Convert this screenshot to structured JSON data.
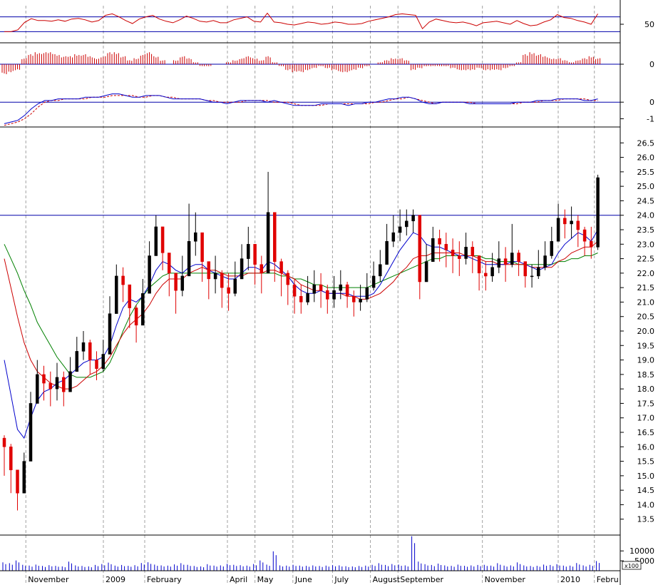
{
  "chart_data": {
    "type": "candlestick",
    "colors": {
      "up_candle": "#000000",
      "down_candle": "#e00000",
      "ma_short": "#0000cc",
      "ma_medium": "#cc0000",
      "ma_long": "#008000",
      "rsi": "#cc0000",
      "histogram": "#cc0000",
      "macd": "#0000cc",
      "signal": "#cc0000",
      "volume": "#0000cc",
      "reference_line": "#0000aa",
      "grid": "#a0a0a0"
    },
    "x_axis": {
      "months": [
        {
          "label": "November",
          "week": 0.0
        },
        {
          "label": "2009",
          "week": 4.5
        },
        {
          "label": "February",
          "week": 6.9
        },
        {
          "label": "April",
          "week": 11.7
        },
        {
          "label": "May",
          "week": 13.3
        },
        {
          "label": "June",
          "week": 15.5
        },
        {
          "label": "July",
          "week": 17.8
        },
        {
          "label": "August",
          "week": 20.0
        },
        {
          "label": "September",
          "week": 21.6
        },
        {
          "label": "November",
          "week": 26.5
        },
        {
          "label": "2010",
          "week": 30.9
        },
        {
          "label": "Febru",
          "week": 33.0
        }
      ],
      "week_range": [
        -1.5,
        34.5
      ]
    },
    "price_panel": {
      "ylim": [
        13.0,
        27.0
      ],
      "ticks": [
        "13.5",
        "14.0",
        "14.5",
        "15.0",
        "15.5",
        "16.0",
        "16.5",
        "17.0",
        "17.5",
        "18.0",
        "18.5",
        "19.0",
        "19.5",
        "20.0",
        "20.5",
        "21.0",
        "21.5",
        "22.0",
        "22.5",
        "23.0",
        "23.5",
        "24.0",
        "24.5",
        "25.0",
        "25.5",
        "26.0",
        "26.5"
      ],
      "reference_line": 24.0,
      "close": [
        16.0,
        15.2,
        14.4,
        15.5,
        17.5,
        18.5,
        18.2,
        18.0,
        18.4,
        17.9,
        18.6,
        19.3,
        19.6,
        19.0,
        18.7,
        19.2,
        20.6,
        21.9,
        21.6,
        20.8,
        20.2,
        21.3,
        22.6,
        23.6,
        22.7,
        22.0,
        21.4,
        21.9,
        23.1,
        23.4,
        22.4,
        21.8,
        22.0,
        21.5,
        21.3,
        21.8,
        22.5,
        23.0,
        22.3,
        22.0,
        24.1,
        22.4,
        22.0,
        21.6,
        21.2,
        21.0,
        21.3,
        21.6,
        21.4,
        21.1,
        21.4,
        21.6,
        21.2,
        21.0,
        21.1,
        21.5,
        21.9,
        22.3,
        23.1,
        23.4,
        23.6,
        23.8,
        24.0,
        21.7,
        22.4,
        23.2,
        23.0,
        22.8,
        22.6,
        22.5,
        22.9,
        22.6,
        22.0,
        21.9,
        22.2,
        22.5,
        22.3,
        22.7,
        22.4,
        21.9,
        21.9,
        22.2,
        22.6,
        23.1,
        23.9,
        23.7,
        23.8,
        23.5,
        23.1,
        22.9,
        25.3
      ],
      "high": [
        16.4,
        16.1,
        15.2,
        15.8,
        17.9,
        19.0,
        18.8,
        18.6,
        18.9,
        18.6,
        19.1,
        19.8,
        20.0,
        19.7,
        19.3,
        19.7,
        21.2,
        22.3,
        22.2,
        21.4,
        20.9,
        21.8,
        23.1,
        24.0,
        23.4,
        22.6,
        22.0,
        22.6,
        24.4,
        24.1,
        23.0,
        22.4,
        22.6,
        22.1,
        22.0,
        22.4,
        23.0,
        23.6,
        22.9,
        22.6,
        25.5,
        23.3,
        22.5,
        22.1,
        21.8,
        21.6,
        21.9,
        22.1,
        22.0,
        21.6,
        21.9,
        22.1,
        21.7,
        21.4,
        21.6,
        22.0,
        22.4,
        22.8,
        23.7,
        24.0,
        24.2,
        24.2,
        24.2,
        22.3,
        23.0,
        23.6,
        23.5,
        23.4,
        23.2,
        23.1,
        23.4,
        23.1,
        22.6,
        22.4,
        22.7,
        23.1,
        22.9,
        23.7,
        22.8,
        22.4,
        22.3,
        22.8,
        23.1,
        23.6,
        24.4,
        24.2,
        24.3,
        24.0,
        23.6,
        23.6,
        25.4
      ],
      "low": [
        15.0,
        14.4,
        13.8,
        14.5,
        16.3,
        17.7,
        17.6,
        17.4,
        17.6,
        17.4,
        18.1,
        18.7,
        19.0,
        18.5,
        18.3,
        18.6,
        19.9,
        21.2,
        21.0,
        20.1,
        19.6,
        20.6,
        21.9,
        22.9,
        22.1,
        21.2,
        20.6,
        21.2,
        22.2,
        22.6,
        21.7,
        21.1,
        21.3,
        20.8,
        20.7,
        21.2,
        21.9,
        22.1,
        21.6,
        21.3,
        22.6,
        21.7,
        21.2,
        20.9,
        20.6,
        20.6,
        20.9,
        21.0,
        20.8,
        20.6,
        20.8,
        21.1,
        20.8,
        20.5,
        20.7,
        21.0,
        21.4,
        21.7,
        22.5,
        22.9,
        23.1,
        23.3,
        23.4,
        21.1,
        21.7,
        22.6,
        22.4,
        22.2,
        22.0,
        21.9,
        22.3,
        22.0,
        21.4,
        21.4,
        21.7,
        22.0,
        21.7,
        22.2,
        21.9,
        21.5,
        21.5,
        21.8,
        22.1,
        22.5,
        23.4,
        23.2,
        23.2,
        22.9,
        22.6,
        22.5,
        22.8
      ],
      "ma_short": [
        19.0,
        17.8,
        16.6,
        16.3,
        17.0,
        17.6,
        17.9,
        18.0,
        18.2,
        18.3,
        18.5,
        18.7,
        18.9,
        19.0,
        19.0,
        19.1,
        19.5,
        20.2,
        20.8,
        21.1,
        21.0,
        21.2,
        21.6,
        22.1,
        22.4,
        22.3,
        22.1,
        22.0,
        22.2,
        22.3,
        22.3,
        22.1,
        22.0,
        21.9,
        21.8,
        21.8,
        22.0,
        22.2,
        22.2,
        22.1,
        22.4,
        22.3,
        22.1,
        21.9,
        21.6,
        21.4,
        21.3,
        21.3,
        21.4,
        21.3,
        21.3,
        21.3,
        21.3,
        21.2,
        21.2,
        21.2,
        21.3,
        21.6,
        22.0,
        22.4,
        22.8,
        23.1,
        23.4,
        23.3,
        23.0,
        22.9,
        22.9,
        22.8,
        22.7,
        22.6,
        22.6,
        22.5,
        22.4,
        22.3,
        22.3,
        22.3,
        22.3,
        22.4,
        22.4,
        22.3,
        22.2,
        22.1,
        22.2,
        22.3,
        22.7,
        23.0,
        23.2,
        23.4,
        23.3,
        23.1,
        23.5
      ],
      "ma_medium": [
        22.5,
        21.5,
        20.5,
        19.6,
        19.0,
        18.6,
        18.4,
        18.2,
        18.1,
        18.0,
        18.0,
        18.1,
        18.3,
        18.5,
        18.6,
        18.8,
        19.1,
        19.5,
        19.9,
        20.2,
        20.4,
        20.6,
        20.9,
        21.3,
        21.6,
        21.8,
        21.8,
        21.8,
        22.0,
        22.1,
        22.2,
        22.1,
        22.1,
        22.0,
        21.9,
        21.9,
        21.9,
        22.0,
        22.0,
        22.0,
        22.1,
        22.1,
        22.0,
        21.9,
        21.8,
        21.6,
        21.5,
        21.4,
        21.4,
        21.3,
        21.3,
        21.3,
        21.2,
        21.2,
        21.1,
        21.1,
        21.2,
        21.3,
        21.5,
        21.7,
        22.0,
        22.2,
        22.5,
        22.6,
        22.6,
        22.7,
        22.7,
        22.7,
        22.7,
        22.7,
        22.6,
        22.6,
        22.5,
        22.4,
        22.4,
        22.3,
        22.3,
        22.3,
        22.3,
        22.3,
        22.2,
        22.2,
        22.2,
        22.2,
        22.4,
        22.5,
        22.7,
        22.8,
        22.9,
        22.9,
        23.1
      ],
      "ma_long": [
        23.0,
        22.5,
        22.0,
        21.4,
        20.9,
        20.3,
        19.9,
        19.5,
        19.1,
        18.8,
        18.5,
        18.4,
        18.4,
        18.4,
        18.5,
        18.6,
        18.9,
        19.4,
        20.0,
        20.5,
        20.9,
        21.2,
        21.5,
        21.7,
        21.9,
        22.0,
        22.0,
        22.0,
        22.0,
        22.0,
        22.0,
        22.0,
        22.0,
        22.0,
        22.0,
        22.0,
        22.0,
        22.0,
        22.0,
        22.0,
        22.0,
        22.0,
        21.9,
        21.9,
        21.8,
        21.8,
        21.7,
        21.6,
        21.6,
        21.5,
        21.5,
        21.5,
        21.5,
        21.5,
        21.5,
        21.5,
        21.6,
        21.7,
        21.8,
        21.9,
        22.0,
        22.1,
        22.2,
        22.3,
        22.4,
        22.5,
        22.5,
        22.6,
        22.6,
        22.6,
        22.6,
        22.6,
        22.6,
        22.5,
        22.5,
        22.4,
        22.4,
        22.4,
        22.3,
        22.3,
        22.3,
        22.3,
        22.3,
        22.3,
        22.4,
        22.4,
        22.5,
        22.5,
        22.6,
        22.6,
        22.7
      ]
    },
    "rsi_panel": {
      "ylim": [
        0,
        100
      ],
      "ticks": [
        "50"
      ],
      "upper_line": 70,
      "lower_line": 30,
      "values": [
        30,
        30,
        35,
        55,
        65,
        60,
        60,
        58,
        62,
        58,
        64,
        66,
        62,
        56,
        60,
        74,
        78,
        70,
        60,
        52,
        64,
        70,
        74,
        64,
        58,
        54,
        62,
        72,
        66,
        58,
        56,
        60,
        54,
        54,
        62,
        66,
        70,
        58,
        56,
        80,
        56,
        54,
        50,
        48,
        52,
        56,
        54,
        50,
        52,
        56,
        54,
        50,
        50,
        52,
        58,
        62,
        66,
        70,
        76,
        78,
        76,
        74,
        38,
        56,
        64,
        60,
        56,
        54,
        56,
        52,
        46,
        54,
        56,
        58,
        54,
        50,
        60,
        52,
        46,
        48,
        56,
        62,
        76,
        68,
        66,
        60,
        56,
        50,
        78
      ]
    },
    "histogram_panel": {
      "ylim": [
        -1,
        1
      ],
      "ticks": [
        "0"
      ],
      "values": [
        -0.5,
        -0.4,
        -0.3,
        0.3,
        0.5,
        0.6,
        0.6,
        0.6,
        0.5,
        0.4,
        0.4,
        0.5,
        0.5,
        0.4,
        0.3,
        0.4,
        0.6,
        0.6,
        0.4,
        0.2,
        0.3,
        0.5,
        0.6,
        0.4,
        0.2,
        0.0,
        0.2,
        0.4,
        0.3,
        0.1,
        -0.1,
        -0.1,
        0.0,
        0.0,
        0.1,
        0.2,
        0.3,
        0.4,
        0.3,
        0.2,
        0.4,
        0.1,
        -0.1,
        -0.3,
        -0.4,
        -0.4,
        -0.3,
        -0.2,
        -0.1,
        -0.2,
        -0.3,
        -0.4,
        -0.4,
        -0.3,
        -0.2,
        -0.1,
        0.0,
        0.1,
        0.2,
        0.3,
        0.3,
        0.2,
        -0.3,
        -0.2,
        -0.1,
        -0.1,
        -0.1,
        -0.1,
        -0.2,
        -0.3,
        -0.3,
        -0.3,
        -0.2,
        -0.3,
        -0.3,
        -0.3,
        -0.2,
        -0.1,
        0.1,
        0.5,
        0.6,
        0.5,
        0.4,
        0.3,
        0.3,
        0.2,
        0.1,
        0.2,
        0.3,
        0.4,
        0.3
      ]
    },
    "macd_panel": {
      "ylim": [
        -1.5,
        1.0
      ],
      "ticks": [
        "0",
        "-1"
      ],
      "macd": [
        -1.3,
        -1.2,
        -1.1,
        -0.8,
        -0.4,
        -0.1,
        0.1,
        0.1,
        0.2,
        0.2,
        0.2,
        0.2,
        0.3,
        0.3,
        0.3,
        0.4,
        0.5,
        0.5,
        0.4,
        0.3,
        0.3,
        0.4,
        0.4,
        0.4,
        0.3,
        0.2,
        0.2,
        0.2,
        0.2,
        0.2,
        0.1,
        0.0,
        0.0,
        -0.1,
        0.0,
        0.1,
        0.1,
        0.1,
        0.1,
        0.0,
        0.1,
        0.0,
        -0.1,
        -0.2,
        -0.2,
        -0.2,
        -0.2,
        -0.1,
        -0.1,
        -0.1,
        -0.1,
        -0.2,
        -0.1,
        -0.1,
        0.0,
        0.0,
        0.1,
        0.2,
        0.2,
        0.3,
        0.3,
        0.2,
        0.0,
        -0.1,
        -0.1,
        0.0,
        0.0,
        0.0,
        0.0,
        -0.1,
        -0.1,
        -0.1,
        -0.1,
        -0.1,
        -0.1,
        -0.1,
        0.0,
        0.0,
        0.0,
        0.1,
        0.1,
        0.1,
        0.2,
        0.2,
        0.2,
        0.2,
        0.1,
        0.1,
        0.2
      ],
      "signal": [
        -1.4,
        -1.3,
        -1.2,
        -1.0,
        -0.7,
        -0.3,
        0.0,
        0.1,
        0.1,
        0.2,
        0.2,
        0.2,
        0.2,
        0.3,
        0.3,
        0.3,
        0.4,
        0.4,
        0.4,
        0.4,
        0.3,
        0.3,
        0.4,
        0.4,
        0.3,
        0.3,
        0.2,
        0.2,
        0.2,
        0.2,
        0.1,
        0.1,
        0.0,
        0.0,
        0.0,
        0.0,
        0.1,
        0.1,
        0.1,
        0.1,
        0.0,
        0.0,
        0.0,
        -0.1,
        -0.2,
        -0.2,
        -0.2,
        -0.2,
        -0.1,
        -0.1,
        -0.1,
        -0.1,
        -0.1,
        -0.1,
        -0.1,
        0.0,
        0.0,
        0.1,
        0.2,
        0.2,
        0.3,
        0.2,
        0.1,
        0.0,
        -0.1,
        0.0,
        0.0,
        0.0,
        0.0,
        0.0,
        -0.1,
        -0.1,
        -0.1,
        -0.1,
        -0.1,
        -0.1,
        -0.1,
        0.0,
        0.0,
        0.0,
        0.1,
        0.1,
        0.1,
        0.2,
        0.2,
        0.2,
        0.2,
        0.1,
        0.1
      ]
    },
    "volume_panel": {
      "ylim": [
        0,
        18000
      ],
      "ticks": [
        "10000",
        "5000"
      ],
      "unit_label": "x100",
      "values": [
        4200,
        3800,
        5200,
        3000,
        2600,
        3100,
        2400,
        2800,
        2500,
        2200,
        4600,
        2700,
        2400,
        2200,
        2900,
        3400,
        4100,
        2600,
        2900,
        2500,
        2800,
        3900,
        4300,
        3100,
        2700,
        2600,
        3200,
        3800,
        3000,
        2400,
        2200,
        3300,
        2600,
        2700,
        3500,
        3000,
        2800,
        2600,
        3400,
        5200,
        3100,
        9800,
        2700,
        2600,
        3000,
        2600,
        2500,
        2700,
        2400,
        2600,
        2800,
        2700,
        2300,
        2200,
        2400,
        2600,
        3000,
        3800,
        2900,
        3400,
        3100,
        2700,
        17400,
        4600,
        3300,
        2900,
        3600,
        2700,
        2500,
        3100,
        2500,
        2700,
        2900,
        3000,
        2600,
        3800,
        2600,
        2700,
        4200,
        2700,
        2400,
        2500,
        3100,
        2900,
        3300,
        2600,
        2600,
        3900,
        2700,
        3000,
        4900
      ]
    }
  }
}
